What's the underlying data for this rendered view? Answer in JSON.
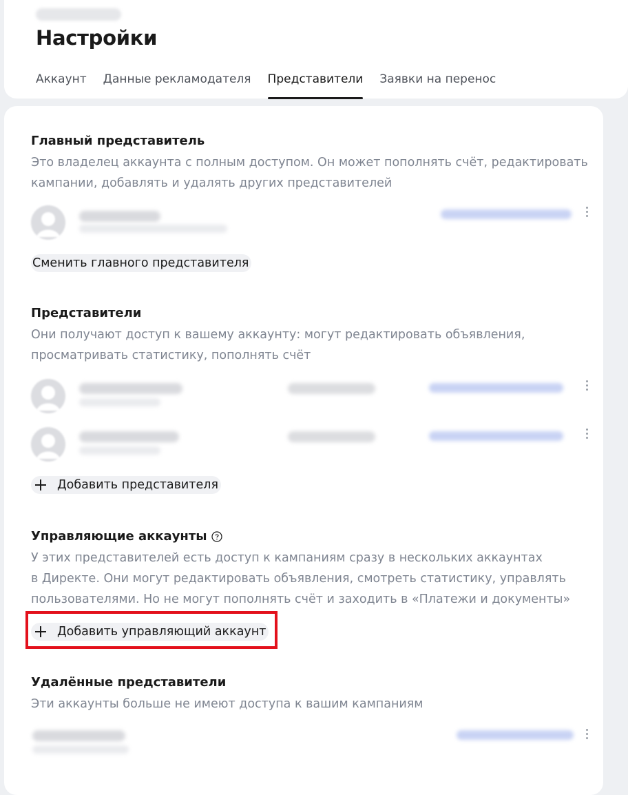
{
  "page": {
    "title": "Настройки",
    "tabs": [
      {
        "label": "Аккаунт",
        "active": false
      },
      {
        "label": "Данные рекламодателя",
        "active": false
      },
      {
        "label": "Представители",
        "active": true
      },
      {
        "label": "Заявки на перенос",
        "active": false
      }
    ]
  },
  "main_rep": {
    "title": "Главный представитель",
    "description": "Это владелец аккаунта с полным доступом. Он может пополнять счёт, редактировать кампании, добавлять и удалять других представителей",
    "change_button": "Сменить главного представителя"
  },
  "reps": {
    "title": "Представители",
    "description": "Они получают доступ к вашему аккаунту: могут редактировать объявления, просматривать статистику, пополнять счёт",
    "add_button": "Добавить представителя"
  },
  "managing": {
    "title": "Управляющие аккаунты",
    "description_lines": [
      "У этих представителей есть доступ к кампаниям сразу в нескольких аккаунтах",
      "в Директе. Они могут редактировать объявления, смотреть статистику, управлять",
      "пользователями. Но не могут пополнять счёт и заходить в «Платежи и документы»"
    ],
    "add_button": "Добавить управляющий аккаунт"
  },
  "deleted": {
    "title": "Удалённые представители",
    "description": "Эти аккаунты больше не имеют доступа к вашим кампаниям"
  },
  "colors": {
    "accent_dark": "#1a1a1a",
    "muted_text": "#7f8591",
    "highlight": "#e3111c"
  }
}
